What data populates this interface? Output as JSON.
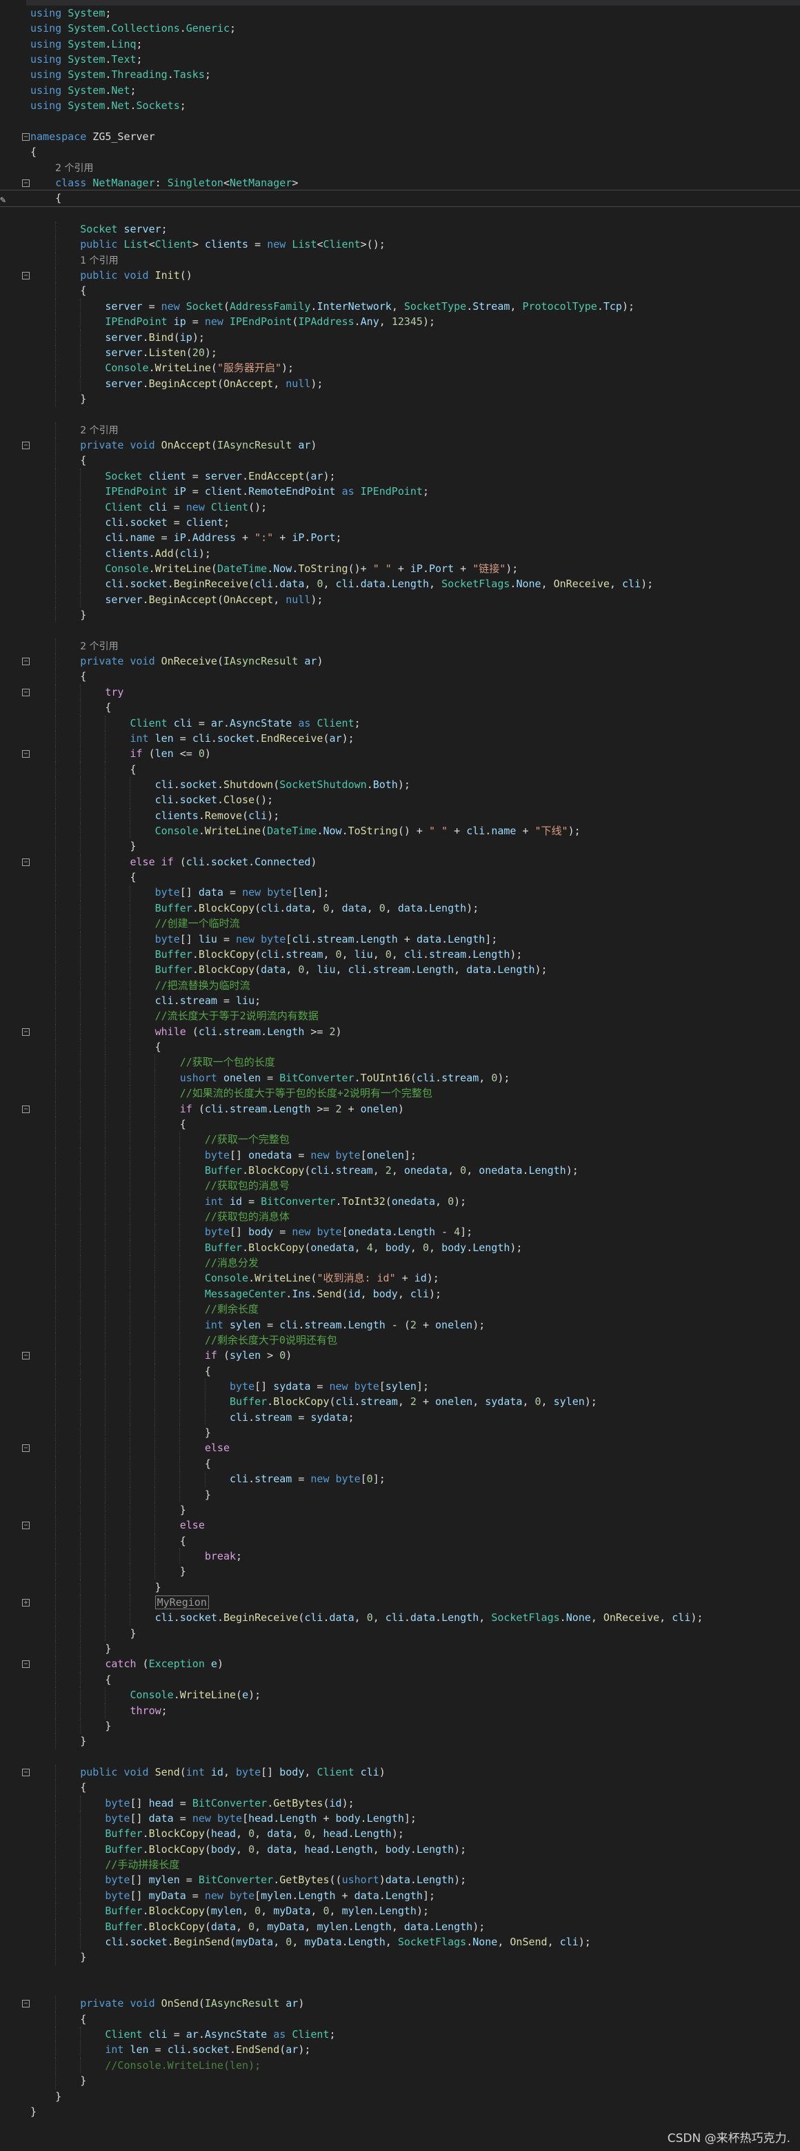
{
  "lines": [
    "using System;",
    "using System.Collections.Generic;",
    "using System.Linq;",
    "using System.Text;",
    "using System.Threading.Tasks;",
    "using System.Net;",
    "using System.Net.Sockets;",
    "",
    "namespace ZG5_Server",
    "{",
    "    2 个引用",
    "    class NetManager: Singleton<NetManager>",
    "    {",
    "",
    "        Socket server;",
    "        public List<Client> clients = new List<Client>();",
    "        1 个引用",
    "        public void Init()",
    "        {",
    "            server = new Socket(AddressFamily.InterNetwork, SocketType.Stream, ProtocolType.Tcp);",
    "            IPEndPoint ip = new IPEndPoint(IPAddress.Any, 12345);",
    "            server.Bind(ip);",
    "            server.Listen(20);",
    "            Console.WriteLine(\"服务器开启\");",
    "            server.BeginAccept(OnAccept, null);",
    "        }",
    "",
    "        2 个引用",
    "        private void OnAccept(IAsyncResult ar)",
    "        {",
    "            Socket client = server.EndAccept(ar);",
    "            IPEndPoint iP = client.RemoteEndPoint as IPEndPoint;",
    "            Client cli = new Client();",
    "            cli.socket = client;",
    "            cli.name = iP.Address + \":\" + iP.Port;",
    "            clients.Add(cli);",
    "            Console.WriteLine(DateTime.Now.ToString()+ \" \" + iP.Port + \"链接\");",
    "            cli.socket.BeginReceive(cli.data, 0, cli.data.Length, SocketFlags.None, OnReceive, cli);",
    "            server.BeginAccept(OnAccept, null);",
    "        }",
    "",
    "        2 个引用",
    "        private void OnReceive(IAsyncResult ar)",
    "        {",
    "            try",
    "            {",
    "                Client cli = ar.AsyncState as Client;",
    "                int len = cli.socket.EndReceive(ar);",
    "                if (len <= 0)",
    "                {",
    "                    cli.socket.Shutdown(SocketShutdown.Both);",
    "                    cli.socket.Close();",
    "                    clients.Remove(cli);",
    "                    Console.WriteLine(DateTime.Now.ToString() + \" \" + cli.name + \"下线\");",
    "                }",
    "                else if (cli.socket.Connected)",
    "                {",
    "                    byte[] data = new byte[len];",
    "                    Buffer.BlockCopy(cli.data, 0, data, 0, data.Length);",
    "                    //创建一个临时流",
    "                    byte[] liu = new byte[cli.stream.Length + data.Length];",
    "                    Buffer.BlockCopy(cli.stream, 0, liu, 0, cli.stream.Length);",
    "                    Buffer.BlockCopy(data, 0, liu, cli.stream.Length, data.Length);",
    "                    //把流替换为临时流",
    "                    cli.stream = liu;",
    "                    //流长度大于等于2说明流内有数据",
    "                    while (cli.stream.Length >= 2)",
    "                    {",
    "                        //获取一个包的长度",
    "                        ushort onelen = BitConverter.ToUInt16(cli.stream, 0);",
    "                        //如果流的长度大于等于包的长度+2说明有一个完整包",
    "                        if (cli.stream.Length >= 2 + onelen)",
    "                        {",
    "                            //获取一个完整包",
    "                            byte[] onedata = new byte[onelen];",
    "                            Buffer.BlockCopy(cli.stream, 2, onedata, 0, onedata.Length);",
    "                            //获取包的消息号",
    "                            int id = BitConverter.ToInt32(onedata, 0);",
    "                            //获取包的消息体",
    "                            byte[] body = new byte[onedata.Length - 4];",
    "                            Buffer.BlockCopy(onedata, 4, body, 0, body.Length);",
    "                            //消息分发",
    "                            Console.WriteLine(\"收到消息: id\" + id);",
    "                            MessageCenter.Ins.Send(id, body, cli);",
    "                            //剩余长度",
    "                            int sylen = cli.stream.Length - (2 + onelen);",
    "                            //剩余长度大于0说明还有包",
    "                            if (sylen > 0)",
    "                            {",
    "                                byte[] sydata = new byte[sylen];",
    "                                Buffer.BlockCopy(cli.stream, 2 + onelen, sydata, 0, sylen);",
    "                                cli.stream = sydata;",
    "                            }",
    "                            else",
    "                            {",
    "                                cli.stream = new byte[0];",
    "                            }",
    "                        }",
    "                        else",
    "                        {",
    "                            break;",
    "                        }",
    "                    }",
    "                    MyRegion",
    "                    cli.socket.BeginReceive(cli.data, 0, cli.data.Length, SocketFlags.None, OnReceive, cli);",
    "                }",
    "            }",
    "            catch (Exception e)",
    "            {",
    "                Console.WriteLine(e);",
    "                throw;",
    "            }",
    "        }",
    "",
    "        public void Send(int id, byte[] body, Client cli)",
    "        {",
    "            byte[] head = BitConverter.GetBytes(id);",
    "            byte[] data = new byte[head.Length + body.Length];",
    "            Buffer.BlockCopy(head, 0, data, 0, head.Length);",
    "            Buffer.BlockCopy(body, 0, data, head.Length, body.Length);",
    "            //手动拼接长度",
    "            byte[] mylen = BitConverter.GetBytes((ushort)data.Length);",
    "            byte[] myData = new byte[mylen.Length + data.Length];",
    "            Buffer.BlockCopy(mylen, 0, myData, 0, mylen.Length);",
    "            Buffer.BlockCopy(data, 0, myData, mylen.Length, data.Length);",
    "            cli.socket.BeginSend(myData, 0, myData.Length, SocketFlags.None, OnSend, cli);",
    "        }",
    "",
    "",
    "        private void OnSend(IAsyncResult ar)",
    "        {",
    "            Client cli = ar.AsyncState as Client;",
    "            int len = cli.socket.EndSend(ar);",
    "            //Console.WriteLine(len);",
    "        }",
    "    }",
    "}"
  ],
  "watermark": "CSDN @来杯热巧克力.",
  "colors": {
    "background": "#1e1e1e",
    "keyword": "#569cd6",
    "type": "#4ec9b0",
    "method": "#dcdcaa",
    "string": "#d69d85",
    "comment": "#57a64a",
    "number": "#b5cea8"
  }
}
